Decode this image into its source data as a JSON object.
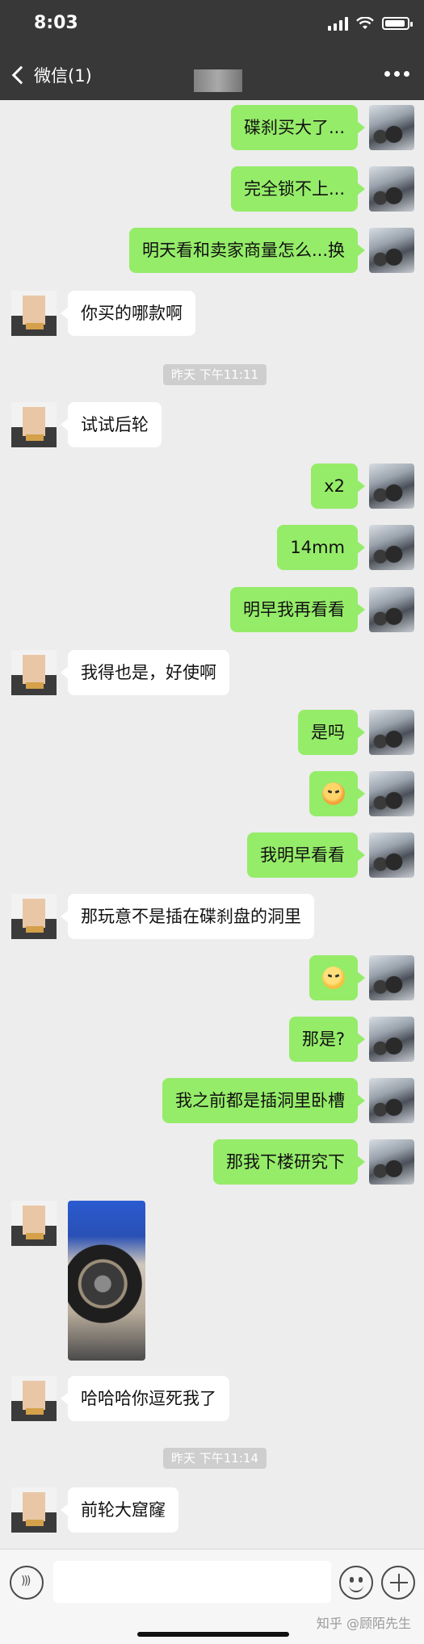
{
  "status_bar": {
    "time": "8:03"
  },
  "nav": {
    "back_label": "微信(1)"
  },
  "timestamps": [
    "昨天 下午11:11",
    "昨天 下午11:14"
  ],
  "messages": [
    {
      "from": "me",
      "text": "碟刹买大了..."
    },
    {
      "from": "me",
      "text": "完全锁不上..."
    },
    {
      "from": "me",
      "text": "明天看和卖家商量怎么...换"
    },
    {
      "from": "other",
      "text": "你买的哪款啊"
    },
    {
      "from": "other",
      "text": "试试后轮"
    },
    {
      "from": "me",
      "text": "x2"
    },
    {
      "from": "me",
      "text": "14mm"
    },
    {
      "from": "me",
      "text": "明早我再看看"
    },
    {
      "from": "other",
      "text": "我得也是，好使啊"
    },
    {
      "from": "me",
      "text": "是吗"
    },
    {
      "from": "me",
      "emoji": "angry-face-emoji"
    },
    {
      "from": "me",
      "text": "我明早看看"
    },
    {
      "from": "other",
      "text": "那玩意不是插在碟刹盘的洞里"
    },
    {
      "from": "me",
      "emoji": "frowning-face-emoji"
    },
    {
      "from": "me",
      "text": "那是?"
    },
    {
      "from": "me",
      "text": "我之前都是插洞里卧槽"
    },
    {
      "from": "me",
      "text": "那我下楼研究下"
    },
    {
      "from": "other",
      "image": "motorcycle-wheel-photo"
    },
    {
      "from": "other",
      "text": "哈哈哈你逗死我了"
    },
    {
      "from": "other",
      "text": "前轮大窟窿"
    }
  ],
  "watermark": "知乎 @顾陌先生",
  "icons": {
    "back": "chevron-left-icon",
    "more": "more-dots-icon",
    "voice": "voice-icon",
    "emoji": "emoji-icon",
    "plus": "plus-icon"
  }
}
